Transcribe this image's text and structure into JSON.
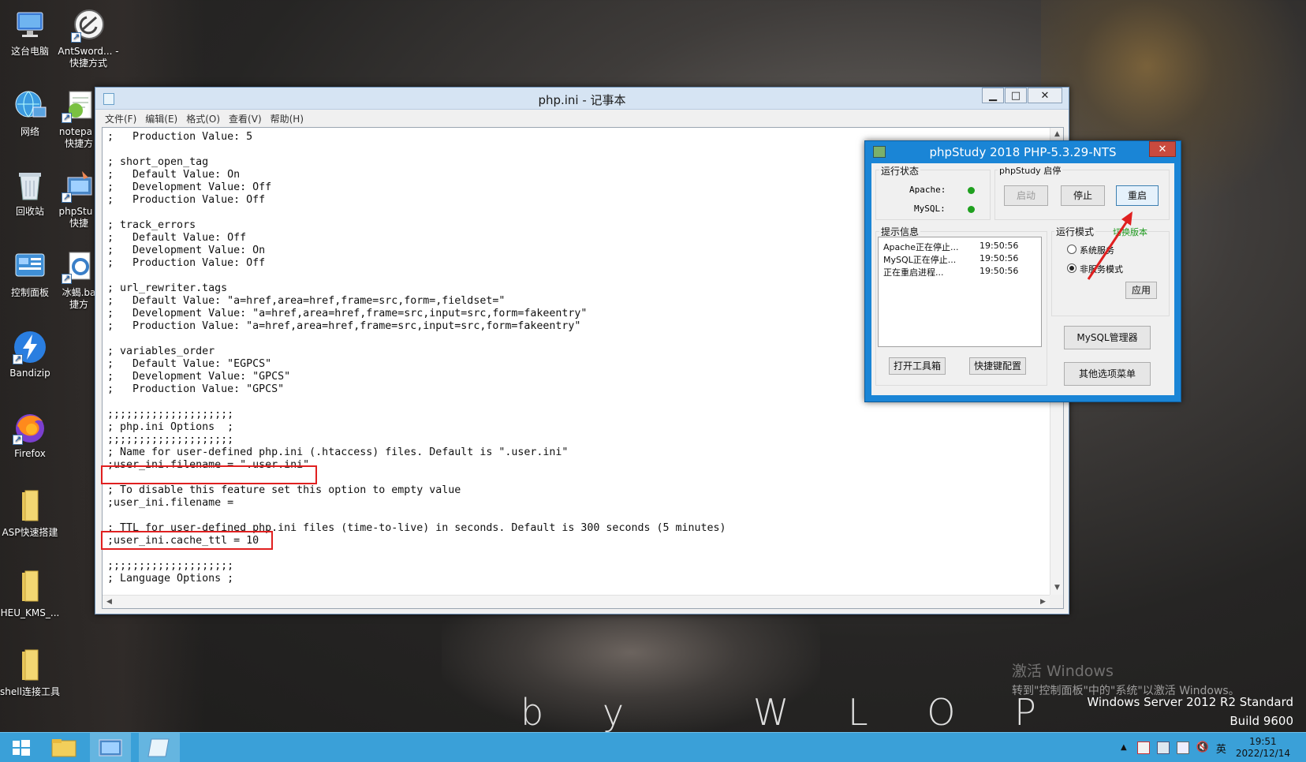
{
  "desktop": {
    "icons": [
      {
        "label": "这台电脑"
      },
      {
        "label": "AntSword... - 快捷方式"
      },
      {
        "label": "网络"
      },
      {
        "label": "notepa - 快捷方"
      },
      {
        "label": "回收站"
      },
      {
        "label": "phpStu - 快捷"
      },
      {
        "label": "控制面板"
      },
      {
        "label": "冰蝎.ba 捷方"
      },
      {
        "label": "Bandizip"
      },
      {
        "label": "Firefox"
      },
      {
        "label": "ASP快速搭建"
      },
      {
        "label": "HEU_KMS_..."
      },
      {
        "label": "shell连接工具"
      }
    ],
    "wallpaper_text": "b y   W L O P",
    "watermark": {
      "line1": "激活 Windows",
      "line2": "转到\"控制面板\"中的\"系统\"以激活 Windows。"
    },
    "os_name": "Windows Server 2012 R2 Standard",
    "os_build": "Build 9600"
  },
  "notepad": {
    "title": "php.ini - 记事本",
    "menu": [
      "文件(F)",
      "编辑(E)",
      "格式(O)",
      "查看(V)",
      "帮助(H)"
    ],
    "content": ";   Production Value: 5\n\n; short_open_tag\n;   Default Value: On\n;   Development Value: Off\n;   Production Value: Off\n\n; track_errors\n;   Default Value: Off\n;   Development Value: On\n;   Production Value: Off\n\n; url_rewriter.tags\n;   Default Value: \"a=href,area=href,frame=src,form=,fieldset=\"\n;   Development Value: \"a=href,area=href,frame=src,input=src,form=fakeentry\"\n;   Production Value: \"a=href,area=href,frame=src,input=src,form=fakeentry\"\n\n; variables_order\n;   Default Value: \"EGPCS\"\n;   Development Value: \"GPCS\"\n;   Production Value: \"GPCS\"\n\n;;;;;;;;;;;;;;;;;;;;\n; php.ini Options  ;\n;;;;;;;;;;;;;;;;;;;;\n; Name for user-defined php.ini (.htaccess) files. Default is \".user.ini\"\n;user_ini.filename = \".user.ini\"\n\n; To disable this feature set this option to empty value\n;user_ini.filename =\n\n; TTL for user-defined php.ini files (time-to-live) in seconds. Default is 300 seconds (5 minutes)\n;user_ini.cache_ttl = 10\n\n;;;;;;;;;;;;;;;;;;;;\n; Language Options ;"
  },
  "phpstudy": {
    "title": "phpStudy 2018   PHP-5.3.29-NTS",
    "status_group": "运行状态",
    "apache_label": "Apache:",
    "mysql_label": "MySQL:",
    "apache_color": "#1fa01f",
    "mysql_color": "#1fa01f",
    "control_group": "phpStudy 启停",
    "start_button": "启动",
    "stop_button": "停止",
    "restart_button": "重启",
    "info_group": "提示信息",
    "log": [
      {
        "message": "Apache正在停止...",
        "time": "19:50:56"
      },
      {
        "message": "MySQL正在停止...",
        "time": "19:50:56"
      },
      {
        "message": "正在重启进程...",
        "time": "19:50:56"
      }
    ],
    "open_toolbox": "打开工具箱",
    "shortcut_config": "快捷键配置",
    "mode_group": "运行模式",
    "switch_version": "切换版本",
    "switch_version_color": "#1f9a1f",
    "mode_options": [
      "系统服务",
      "非服务模式"
    ],
    "mode_selected": "非服务模式",
    "apply_button": "应用",
    "mysql_manager": "MySQL管理器",
    "other_menu": "其他选项菜单"
  },
  "taskbar": {
    "clock_time": "19:51",
    "clock_date": "2022/12/14",
    "ime": "英"
  },
  "colors": {
    "highlight_box": "#e02020",
    "taskbar": "#3aa0d8",
    "phpstudy_frame": "#1a85d6"
  }
}
